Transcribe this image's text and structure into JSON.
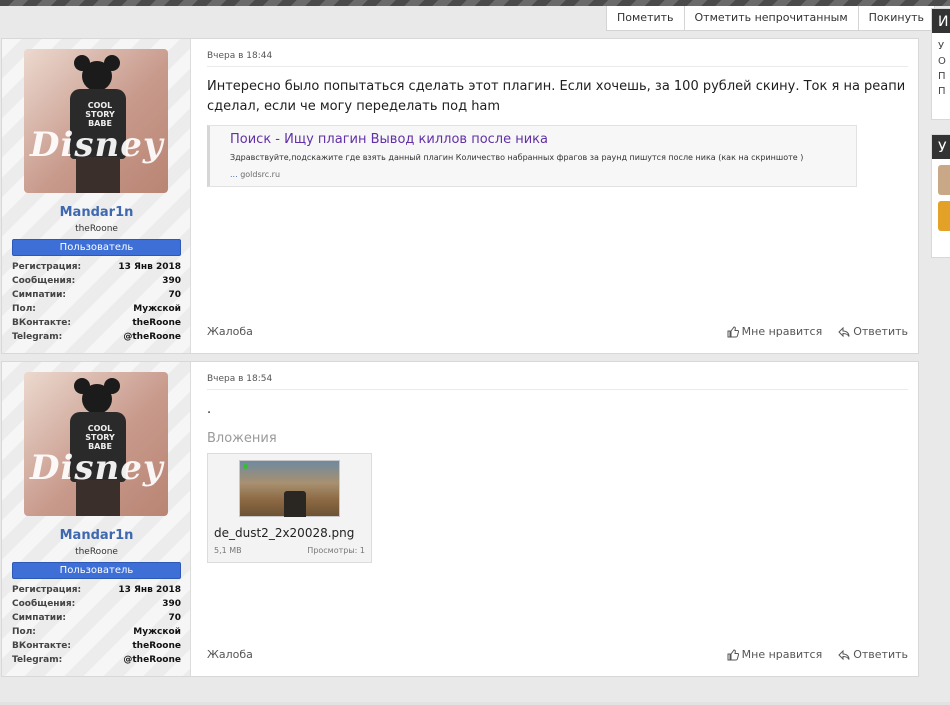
{
  "toolbar": {
    "mark": "Пометить",
    "mark_unread": "Отметить непрочитанным",
    "leave": "Покинуть"
  },
  "posts": [
    {
      "date": "Вчера в 18:44",
      "user": {
        "name": "Mandar1n",
        "title": "theRoone",
        "role": "Пользователь",
        "shirt_text": "COOL STORY BABE",
        "avatar_logo": "Disney",
        "stats": [
          {
            "k": "Регистрация:",
            "v": "13 Янв 2018"
          },
          {
            "k": "Сообщения:",
            "v": "390"
          },
          {
            "k": "Симпатии:",
            "v": "70"
          },
          {
            "k": "Пол:",
            "v": "Мужской"
          },
          {
            "k": "ВКонтакте:",
            "v": "theRoone"
          },
          {
            "k": "Telegram:",
            "v": "@theRoone"
          }
        ]
      },
      "body": "Интересно было попытаться сделать этот плагин. Если хочешь, за 100 рублей скину. Ток я на реапи сделал, если че могу переделать под ham",
      "quote": {
        "title": "Поиск - Ищу плагин Вывод киллов после ника",
        "desc": "Здравствуйте,подскажите где взять данный плагин Количество набранных фрагов за раунд пишутся после ника (как на скриншоте )",
        "dots": "...",
        "source": "goldsrc.ru"
      },
      "complain": "Жалоба",
      "like": "Мне нравится",
      "reply": "Ответить"
    },
    {
      "date": "Вчера в 18:54",
      "user": {
        "name": "Mandar1n",
        "title": "theRoone",
        "role": "Пользователь",
        "shirt_text": "COOL STORY BABE",
        "avatar_logo": "Disney",
        "stats": [
          {
            "k": "Регистрация:",
            "v": "13 Янв 2018"
          },
          {
            "k": "Сообщения:",
            "v": "390"
          },
          {
            "k": "Симпатии:",
            "v": "70"
          },
          {
            "k": "Пол:",
            "v": "Мужской"
          },
          {
            "k": "ВКонтакте:",
            "v": "theRoone"
          },
          {
            "k": "Telegram:",
            "v": "@theRoone"
          }
        ]
      },
      "body": ".",
      "attachments_title": "Вложения",
      "attachment": {
        "filename": "de_dust2_2x20028.png",
        "size": "5,1 MB",
        "views": "Просмотры: 1"
      },
      "complain": "Жалоба",
      "like": "Мне нравится",
      "reply": "Ответить"
    }
  ],
  "sidebar": {
    "block1_header": "И",
    "block1_lines": [
      "У",
      "О",
      "П",
      "П"
    ],
    "block2_header": "У"
  },
  "colors": {
    "username": "#3e68b0",
    "role_badge": "#3d6fd6",
    "quote_title": "#6030a8"
  }
}
